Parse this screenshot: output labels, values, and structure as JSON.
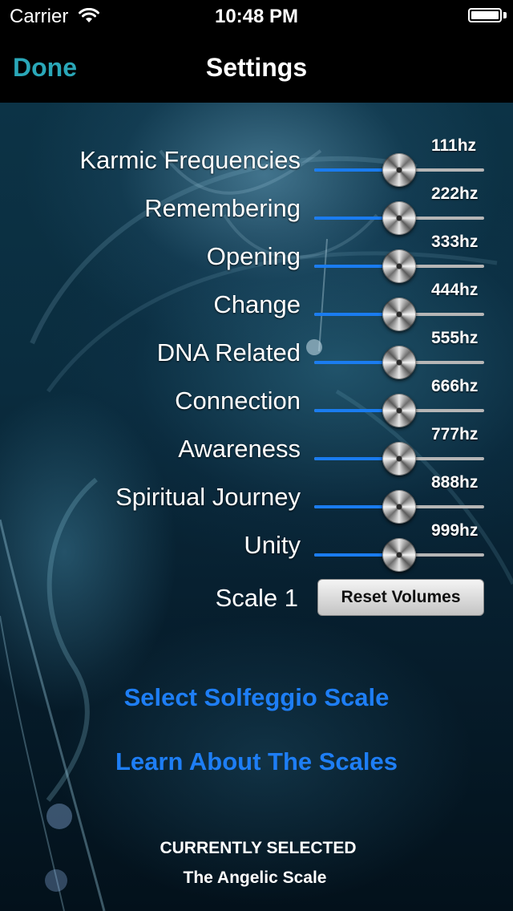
{
  "status_bar": {
    "carrier": "Carrier",
    "time": "10:48 PM",
    "wifi_icon": "wifi-icon",
    "battery_icon": "battery-icon"
  },
  "nav": {
    "done_label": "Done",
    "title": "Settings"
  },
  "frequencies": [
    {
      "label": "Karmic Frequencies",
      "hz": "111hz",
      "volume": 0.5
    },
    {
      "label": "Remembering",
      "hz": "222hz",
      "volume": 0.5
    },
    {
      "label": "Opening",
      "hz": "333hz",
      "volume": 0.5
    },
    {
      "label": "Change",
      "hz": "444hz",
      "volume": 0.5
    },
    {
      "label": "DNA Related",
      "hz": "555hz",
      "volume": 0.5
    },
    {
      "label": "Connection",
      "hz": "666hz",
      "volume": 0.5
    },
    {
      "label": "Awareness",
      "hz": "777hz",
      "volume": 0.5
    },
    {
      "label": "Spiritual Journey",
      "hz": "888hz",
      "volume": 0.5
    },
    {
      "label": "Unity",
      "hz": "999hz",
      "volume": 0.5
    }
  ],
  "scale": {
    "label": "Scale 1",
    "reset_label": "Reset Volumes"
  },
  "links": {
    "select_scale": "Select Solfeggio Scale",
    "learn_scales": "Learn About The Scales"
  },
  "current": {
    "heading": "CURRENTLY SELECTED",
    "value": "The Angelic Scale"
  },
  "colors": {
    "accent_blue": "#1e7ef5",
    "done_teal": "#2aa7b8",
    "slider_fill": "#1a7cf0"
  }
}
